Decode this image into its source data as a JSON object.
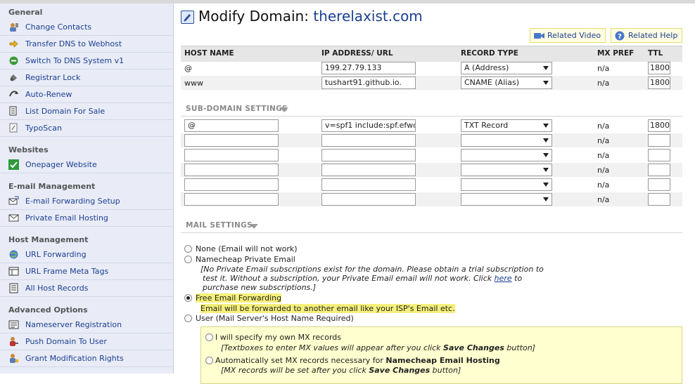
{
  "sidebar": {
    "sections": [
      {
        "title": "General",
        "items": [
          {
            "label": "Change Contacts",
            "icon": "contacts-icon"
          },
          {
            "label": "Transfer DNS to Webhost",
            "icon": "arrow-right-icon"
          },
          {
            "label": "Switch To DNS System v1",
            "icon": "dns-switch-icon"
          },
          {
            "label": "Registrar Lock",
            "icon": "lock-icon"
          },
          {
            "label": "Auto-Renew",
            "icon": "renew-icon"
          },
          {
            "label": "List Domain For Sale",
            "icon": "listing-icon"
          },
          {
            "label": "TypoScan",
            "icon": "typoscan-icon"
          }
        ]
      },
      {
        "title": "Websites",
        "items": [
          {
            "label": "Onepager Website",
            "icon": "checkmark-icon"
          }
        ]
      },
      {
        "title": "E-mail Management",
        "items": [
          {
            "label": "E-mail Forwarding Setup",
            "icon": "mail-forward-icon"
          },
          {
            "label": "Private Email Hosting",
            "icon": "mail-icon"
          }
        ]
      },
      {
        "title": "Host Management",
        "items": [
          {
            "label": "URL Forwarding",
            "icon": "globe-icon"
          },
          {
            "label": "URL Frame Meta Tags",
            "icon": "frame-icon"
          },
          {
            "label": "All Host Records",
            "icon": "records-icon"
          }
        ]
      },
      {
        "title": "Advanced Options",
        "items": [
          {
            "label": "Nameserver Registration",
            "icon": "nameserver-icon"
          },
          {
            "label": "Push Domain To User",
            "icon": "push-user-icon"
          },
          {
            "label": "Grant Modification Rights",
            "icon": "rights-icon"
          }
        ]
      }
    ]
  },
  "main": {
    "title_prefix": "Modify Domain:",
    "domain": "therelaxist.com",
    "related_video": "Related Video",
    "related_help": "Related Help",
    "columns": [
      "HOST NAME",
      "IP ADDRESS/ URL",
      "RECORD TYPE",
      "MX PREF",
      "TTL"
    ],
    "host_records": [
      {
        "host": "@",
        "ip": "199.27.79.133",
        "type": "A (Address)",
        "mx": "n/a",
        "ttl": "1800"
      },
      {
        "host": "www",
        "ip": "tushart91.github.io.",
        "type": "CNAME (Alias)",
        "mx": "n/a",
        "ttl": "1800"
      }
    ],
    "subdomain_title": "SUB-DOMAIN SETTINGS",
    "subdomain_records": [
      {
        "host": "@",
        "ip": "v=spf1 include:spf.efwd",
        "type": "TXT Record",
        "mx": "n/a",
        "ttl": "1800"
      },
      {
        "host": "",
        "ip": "",
        "type": "",
        "mx": "n/a",
        "ttl": ""
      },
      {
        "host": "",
        "ip": "",
        "type": "",
        "mx": "n/a",
        "ttl": ""
      },
      {
        "host": "",
        "ip": "",
        "type": "",
        "mx": "n/a",
        "ttl": ""
      },
      {
        "host": "",
        "ip": "",
        "type": "",
        "mx": "n/a",
        "ttl": ""
      },
      {
        "host": "",
        "ip": "",
        "type": "",
        "mx": "n/a",
        "ttl": ""
      }
    ],
    "mail_title": "MAIL SETTINGS",
    "mail": {
      "none": "None (Email will not work)",
      "private": "Namecheap Private Email",
      "private_note_1": "[No Private Email subscriptions exist for the domain. Please obtain a trial subscription to",
      "private_note_2_pre": "test it. Without a subscription, your Private Email email will not work. Click ",
      "private_note_link": "here",
      "private_note_2_post": " to",
      "private_note_3": "purchase new subscriptions.]",
      "forwarding": "Free Email Forwarding",
      "forwarding_note": "Email will be forwarded to another email like your ISP's Email etc.",
      "user": "User (Mail Server's Host Name Required)",
      "mx_own": "I will specify my own MX records",
      "mx_own_note_pre": "[Textboxes to enter MX values will appear after you click ",
      "mx_own_note_bold": "Save Changes",
      "mx_own_note_post": " button]",
      "mx_auto_pre": "Automatically set MX records necessary for ",
      "mx_auto_bold": "Namecheap Email Hosting",
      "mx_auto_note_pre": "[MX records will be set after you click ",
      "mx_auto_note_bold": "Save Changes",
      "mx_auto_note_post": " button]",
      "selected": "forwarding"
    }
  }
}
